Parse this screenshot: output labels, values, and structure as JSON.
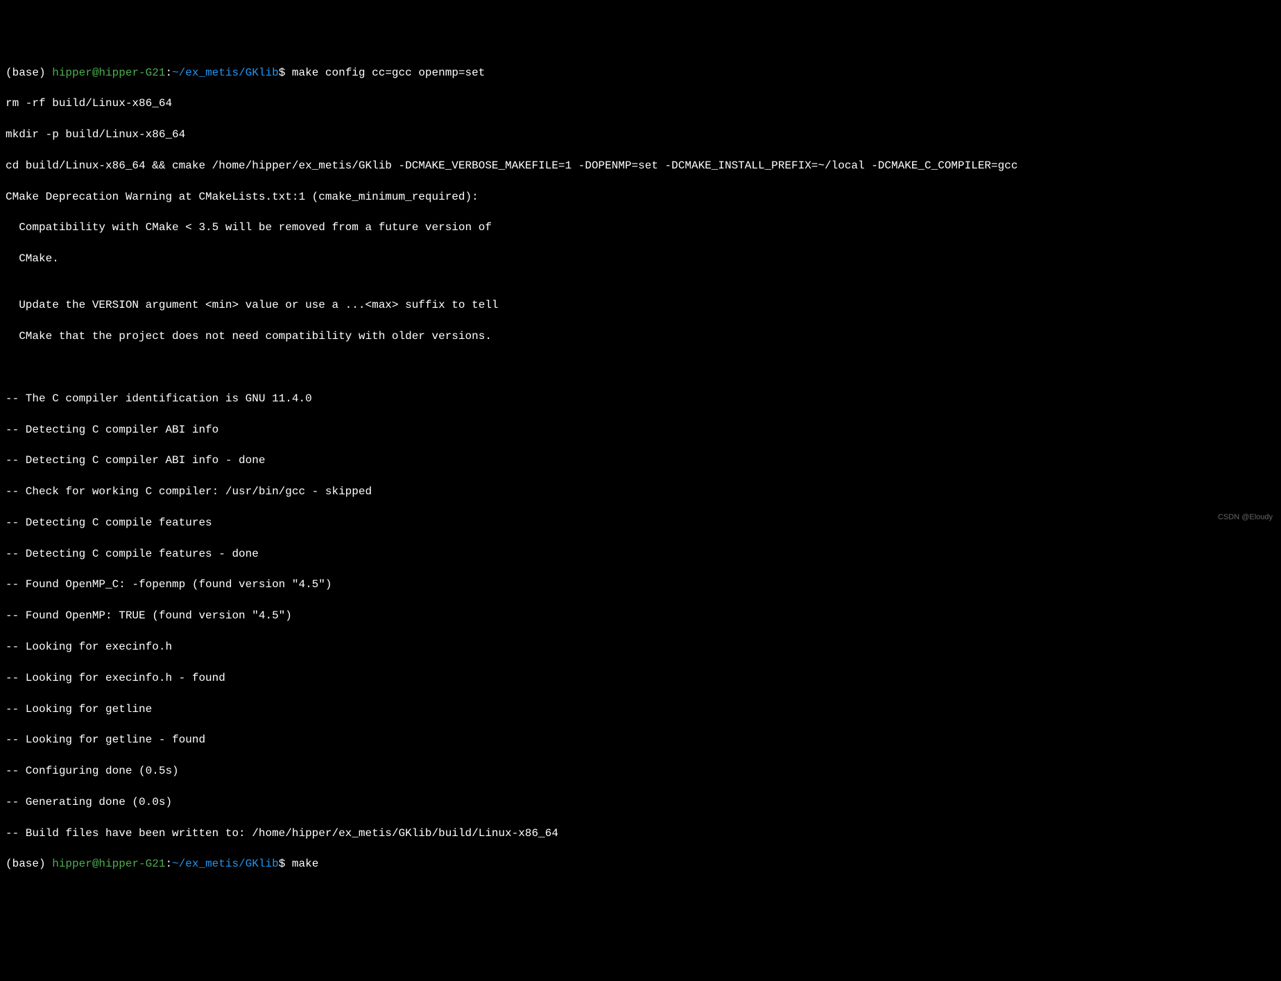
{
  "colors": {
    "background": "#000000",
    "text": "#ffffff",
    "user_host": "#4caf50",
    "path": "#2196f3",
    "watermark": "#666666"
  },
  "prompt1": {
    "env": "(base) ",
    "user_host": "hipper@hipper-G21",
    "colon": ":",
    "path": "~/ex_metis/GKlib",
    "symbol": "$ ",
    "command": "make config cc=gcc openmp=set"
  },
  "output_lines": {
    "l0": "rm -rf build/Linux-x86_64",
    "l1": "mkdir -p build/Linux-x86_64",
    "l2": "cd build/Linux-x86_64 && cmake /home/hipper/ex_metis/GKlib -DCMAKE_VERBOSE_MAKEFILE=1 -DOPENMP=set -DCMAKE_INSTALL_PREFIX=~/local -DCMAKE_C_COMPILER=gcc",
    "l3": "CMake Deprecation Warning at CMakeLists.txt:1 (cmake_minimum_required):",
    "l4": "  Compatibility with CMake < 3.5 will be removed from a future version of",
    "l5": "  CMake.",
    "l6": "",
    "l7": "  Update the VERSION argument <min> value or use a ...<max> suffix to tell",
    "l8": "  CMake that the project does not need compatibility with older versions.",
    "l9": "",
    "l10": "",
    "l11": "-- The C compiler identification is GNU 11.4.0",
    "l12": "-- Detecting C compiler ABI info",
    "l13": "-- Detecting C compiler ABI info - done",
    "l14": "-- Check for working C compiler: /usr/bin/gcc - skipped",
    "l15": "-- Detecting C compile features",
    "l16": "-- Detecting C compile features - done",
    "l17": "-- Found OpenMP_C: -fopenmp (found version \"4.5\")",
    "l18": "-- Found OpenMP: TRUE (found version \"4.5\")",
    "l19": "-- Looking for execinfo.h",
    "l20": "-- Looking for execinfo.h - found",
    "l21": "-- Looking for getline",
    "l22": "-- Looking for getline - found",
    "l23": "-- Configuring done (0.5s)",
    "l24": "-- Generating done (0.0s)",
    "l25": "-- Build files have been written to: /home/hipper/ex_metis/GKlib/build/Linux-x86_64"
  },
  "prompt2": {
    "env": "(base) ",
    "user_host": "hipper@hipper-G21",
    "colon": ":",
    "path": "~/ex_metis/GKlib",
    "symbol": "$ ",
    "command": "make"
  },
  "watermark": "CSDN @Eloudy"
}
